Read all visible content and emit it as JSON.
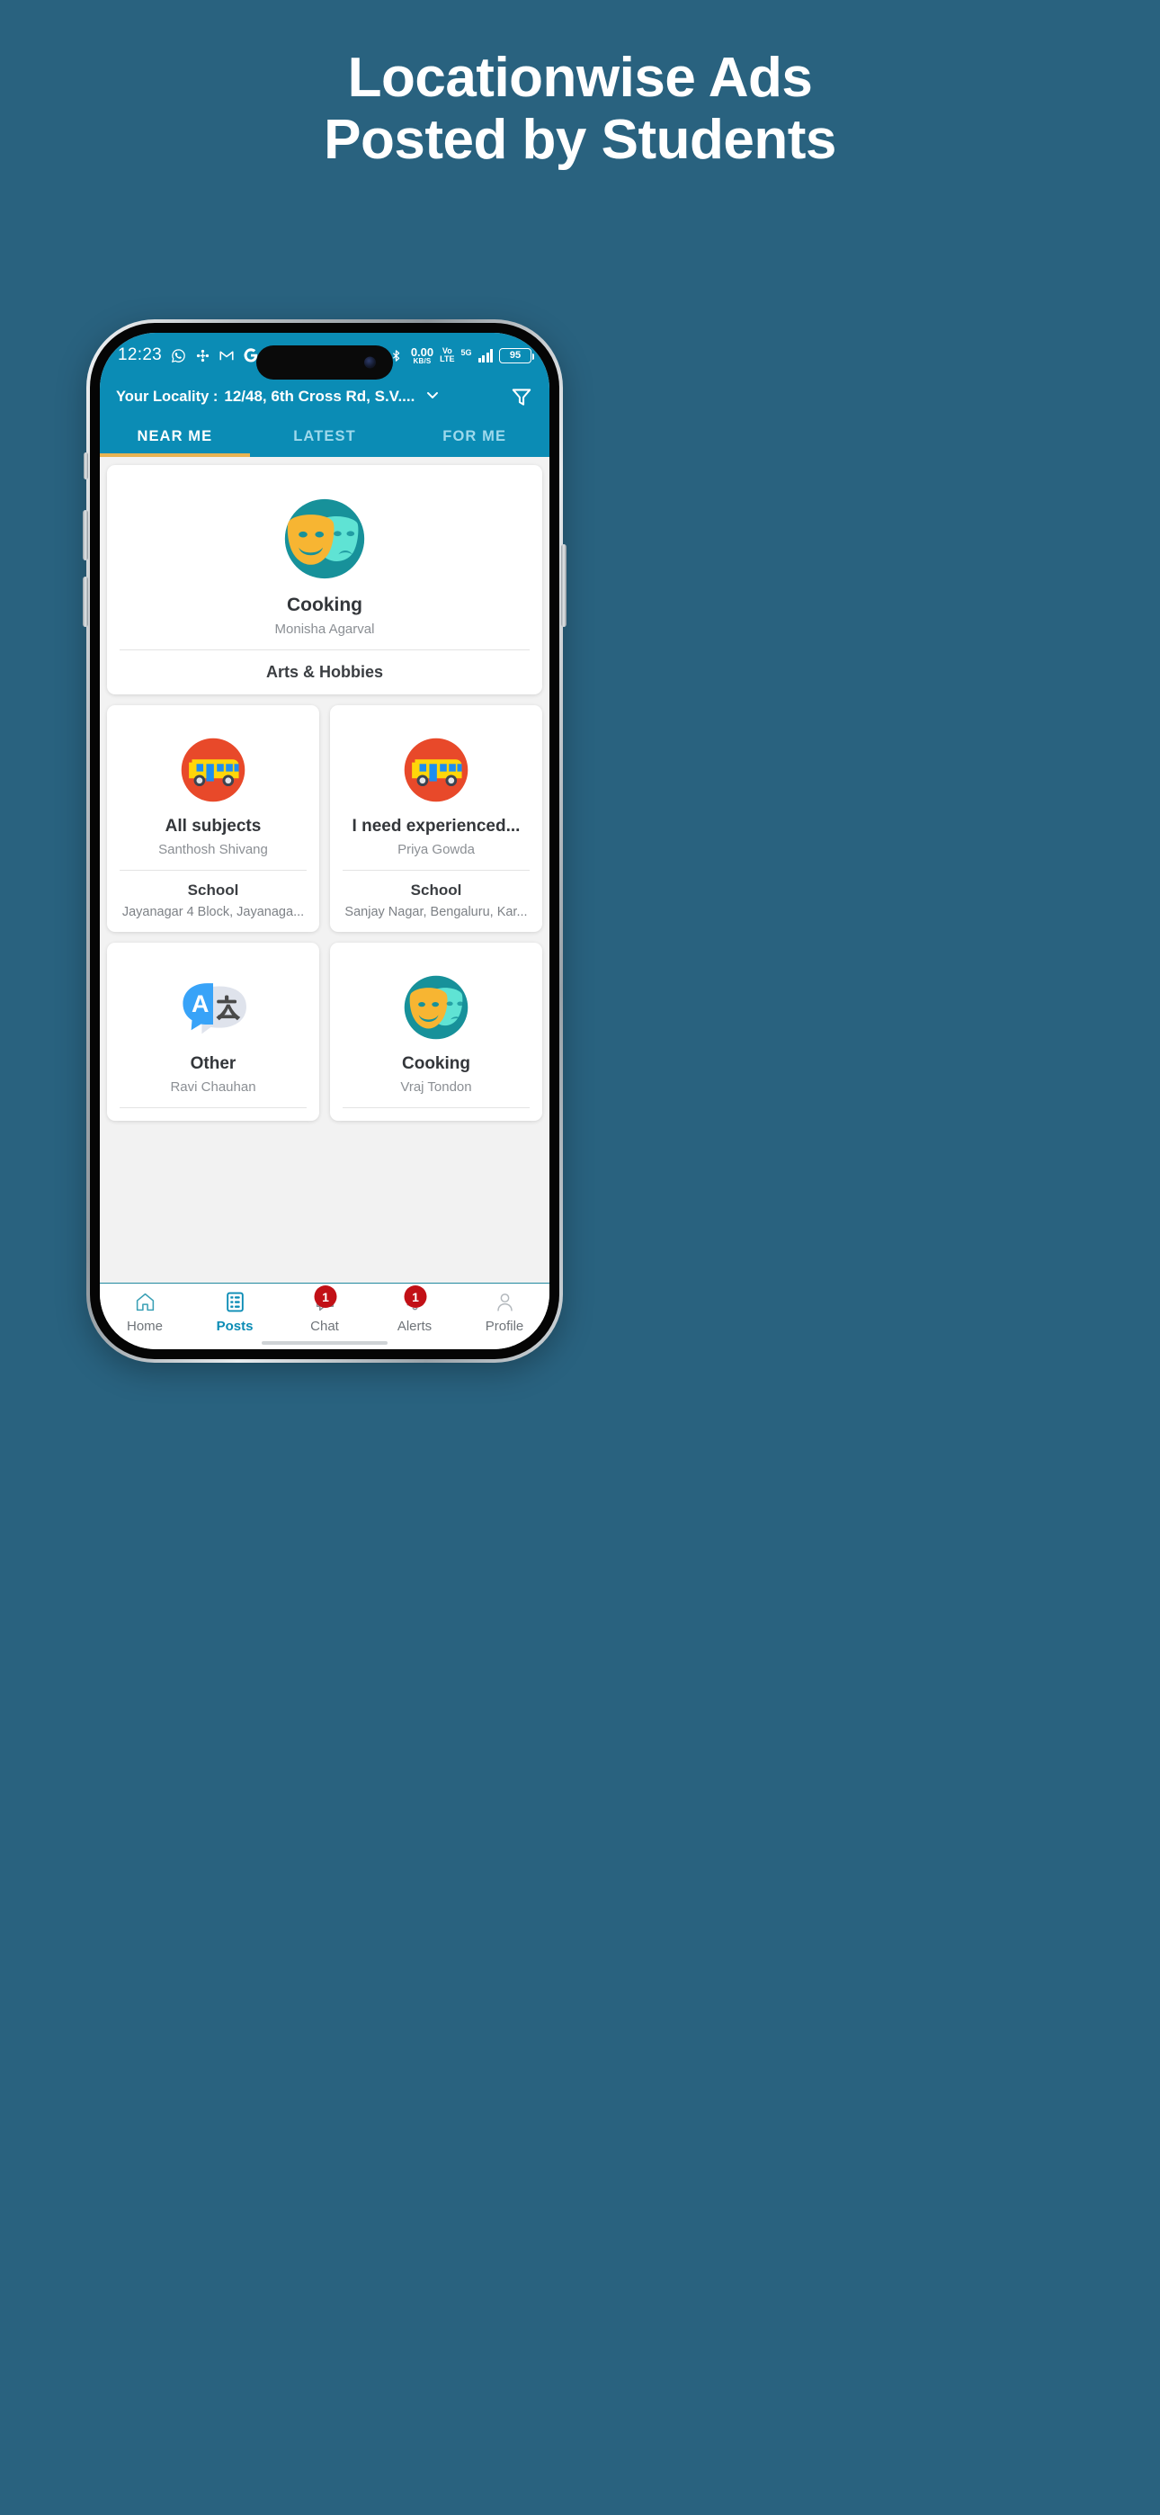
{
  "promo": {
    "line1": "Locationwise Ads",
    "line2": "Posted by Students"
  },
  "colors": {
    "page_background": "#29627f",
    "app_bar": "#0b8cb5",
    "tab_active_underline": "#e8b352",
    "badge_red": "#c21016",
    "accent_teal": "#0b8cb5"
  },
  "status_bar": {
    "time": "12:23",
    "left_icons": [
      "whatsapp-icon",
      "bluetooth-share-icon",
      "gmail-icon",
      "google-icon"
    ],
    "data_rate_value": "0.00",
    "data_rate_unit": "KB/S",
    "volte_top": "Vo",
    "volte_bottom": "LTE",
    "network": "5G",
    "battery": "95",
    "bluetooth": "bluetooth-icon"
  },
  "app_bar": {
    "locality_label": "Your Locality :",
    "locality_value": "12/48, 6th Cross Rd, S.V....",
    "chevron": "chevron-down-icon",
    "filter": "filter-funnel-icon"
  },
  "tabs": [
    {
      "label": "NEAR ME",
      "active": true
    },
    {
      "label": "LATEST",
      "active": false
    },
    {
      "label": "FOR ME",
      "active": false
    }
  ],
  "hero_card": {
    "icon": "theater-masks-icon",
    "title": "Cooking",
    "author": "Monisha Agarval",
    "category": "Arts & Hobbies"
  },
  "cards": [
    {
      "icon": "school-bus-icon",
      "title": "All subjects",
      "author": "Santhosh Shivang",
      "category": "School",
      "address": "Jayanagar 4 Block, Jayanaga..."
    },
    {
      "icon": "school-bus-icon",
      "title": "I need experienced...",
      "author": "Priya Gowda",
      "category": "School",
      "address": "Sanjay Nagar, Bengaluru, Kar..."
    },
    {
      "icon": "translate-icon",
      "title": "Other",
      "author": "Ravi Chauhan",
      "category": "",
      "address": ""
    },
    {
      "icon": "theater-masks-icon",
      "title": "Cooking",
      "author": "Vraj Tondon",
      "category": "",
      "address": ""
    }
  ],
  "bottom_nav": [
    {
      "label": "Home",
      "icon": "home-icon",
      "active": false,
      "badge": ""
    },
    {
      "label": "Posts",
      "icon": "posts-icon",
      "active": true,
      "badge": ""
    },
    {
      "label": "Chat",
      "icon": "chat-icon",
      "active": false,
      "badge": "1"
    },
    {
      "label": "Alerts",
      "icon": "bell-icon",
      "active": false,
      "badge": "1"
    },
    {
      "label": "Profile",
      "icon": "profile-icon",
      "active": false,
      "badge": ""
    }
  ]
}
